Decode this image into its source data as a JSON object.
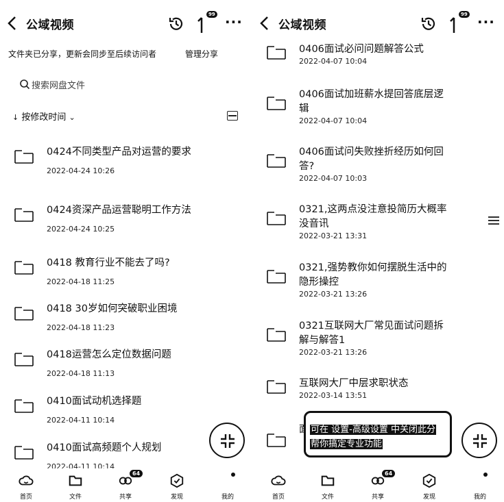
{
  "left": {
    "title": "公域视频",
    "upload_badge": "99",
    "more": "···",
    "notice": "文件夹已分享，更新会同步至后续访问者",
    "manage": "管理分享",
    "search_placeholder": "搜索网盘文件",
    "sort_label": "按修改时间",
    "files": [
      {
        "name": "0424不同类型产品对运营的要求",
        "date": "2022-04-24 10:26"
      },
      {
        "name": "0424资深产品运营聪明工作方法",
        "date": "2022-04-24 10:25"
      },
      {
        "name": "0418 教育行业不能去了吗?",
        "date": "2022-04-18 11:25"
      },
      {
        "name": "0418 30岁如何突破职业困境",
        "date": "2022-04-18 11:23"
      },
      {
        "name": "0418运营怎么定位数据问题",
        "date": "2022-04-18 11:13"
      },
      {
        "name": "0410面试动机选择题",
        "date": "2022-04-11 10:14"
      },
      {
        "name": "0410面试高频题个人规划",
        "date": "2022-04-11 10:14"
      }
    ],
    "tabs": [
      {
        "label": "首页",
        "icon": "cloud-icon"
      },
      {
        "label": "文件",
        "icon": "folder-icon"
      },
      {
        "label": "共享",
        "icon": "share-icon",
        "badge": "64"
      },
      {
        "label": "发现",
        "icon": "discover-icon"
      },
      {
        "label": "我的",
        "icon": "profile-icon"
      }
    ]
  },
  "right": {
    "title": "公域视频",
    "upload_badge": "99",
    "more": "···",
    "files": [
      {
        "name": "0406面试必问问题解答公式",
        "date": "2022-04-07 10:04"
      },
      {
        "name": "0406面试加班薪水提回答底层逻辑",
        "date": "2022-04-07 10:04"
      },
      {
        "name": "0406面试问失败挫折经历如何回答?",
        "date": "2022-04-07 10:03"
      },
      {
        "name": "0321,这两点没注意投简历大概率没音讯",
        "date": "2022-03-21 13:31"
      },
      {
        "name": "0321,强势教你如何摆脱生活中的隐形操控",
        "date": "2022-03-21 13:26"
      },
      {
        "name": "0321互联网大厂常见面试问题拆解与解答1",
        "date": "2022-03-21 13:26"
      },
      {
        "name": "互联网大厂中层求职状态",
        "date": "2022-03-14 13:51"
      }
    ],
    "toast_line1": "可在 设置-高级设置 中关闭此分",
    "toast_line2": "帮你搞定专业功能",
    "under_text": "面试",
    "tabs": [
      {
        "label": "首页",
        "icon": "cloud-icon"
      },
      {
        "label": "文件",
        "icon": "folder-icon"
      },
      {
        "label": "共享",
        "icon": "share-icon",
        "badge": "64"
      },
      {
        "label": "发现",
        "icon": "discover-icon"
      },
      {
        "label": "我的",
        "icon": "profile-icon"
      }
    ]
  }
}
